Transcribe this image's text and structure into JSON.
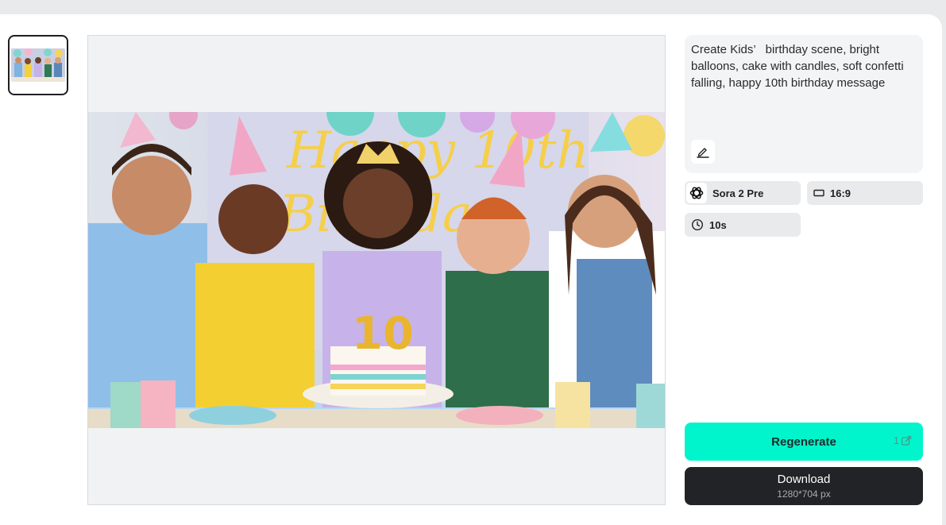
{
  "history": {
    "thumbnail_icon": "generated-video-thumbnail"
  },
  "preview": {
    "image_description_icon": "birthday-party-image"
  },
  "prompt": {
    "text": "Create Kids’   birthday scene, bright balloons, cake with candles, soft confetti falling, happy 10th birthday message",
    "edit_icon": "edit-pen-icon"
  },
  "settings": {
    "model": "Sora 2 Pre",
    "model_icon": "openai-logo-icon",
    "aspect_ratio": "16:9",
    "aspect_icon": "aspect-ratio-icon",
    "duration": "10s",
    "duration_icon": "clock-icon"
  },
  "actions": {
    "regenerate_label": "Regenerate",
    "regenerate_cost": "1",
    "regenerate_cost_icon": "credit-icon",
    "download_label": "Download",
    "download_size": "1280*704 px"
  },
  "colors": {
    "regenerate_bg": "#00f5cc",
    "download_bg": "#222326"
  }
}
